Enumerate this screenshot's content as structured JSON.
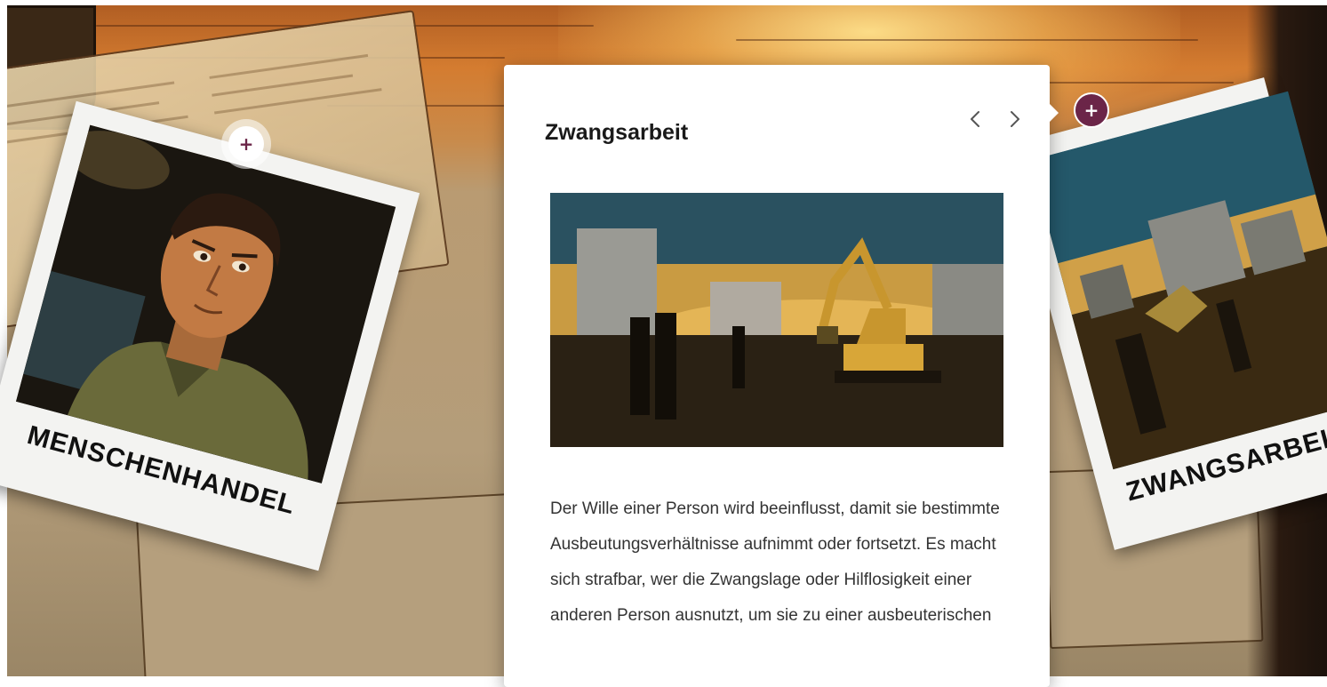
{
  "card": {
    "title": "Zwangsarbeit",
    "prev_icon": "chevron-left-icon",
    "next_icon": "chevron-right-icon",
    "image_alt": "Zwangsarbeit",
    "description": "Der Wille einer Person wird beeinflusst, damit sie bestimmte Ausbeutungsverhältnisse aufnimmt oder fortsetzt. Es macht sich strafbar, wer die Zwangslage oder Hilflosigkeit einer anderen Person ausnutzt, um sie zu einer ausbeuterischen"
  },
  "polaroids": [
    {
      "caption": "MENSCHENHANDEL",
      "hotspot_icon": "plus-icon"
    },
    {
      "caption": "ZWANGSARBEIT",
      "hotspot_icon": "plus-icon"
    }
  ],
  "hotspots": {
    "left": {
      "symbol": "+"
    },
    "right": {
      "symbol": "+"
    }
  },
  "colors": {
    "accent": "#6b2548",
    "card_background": "#ffffff",
    "text": "#333333"
  }
}
